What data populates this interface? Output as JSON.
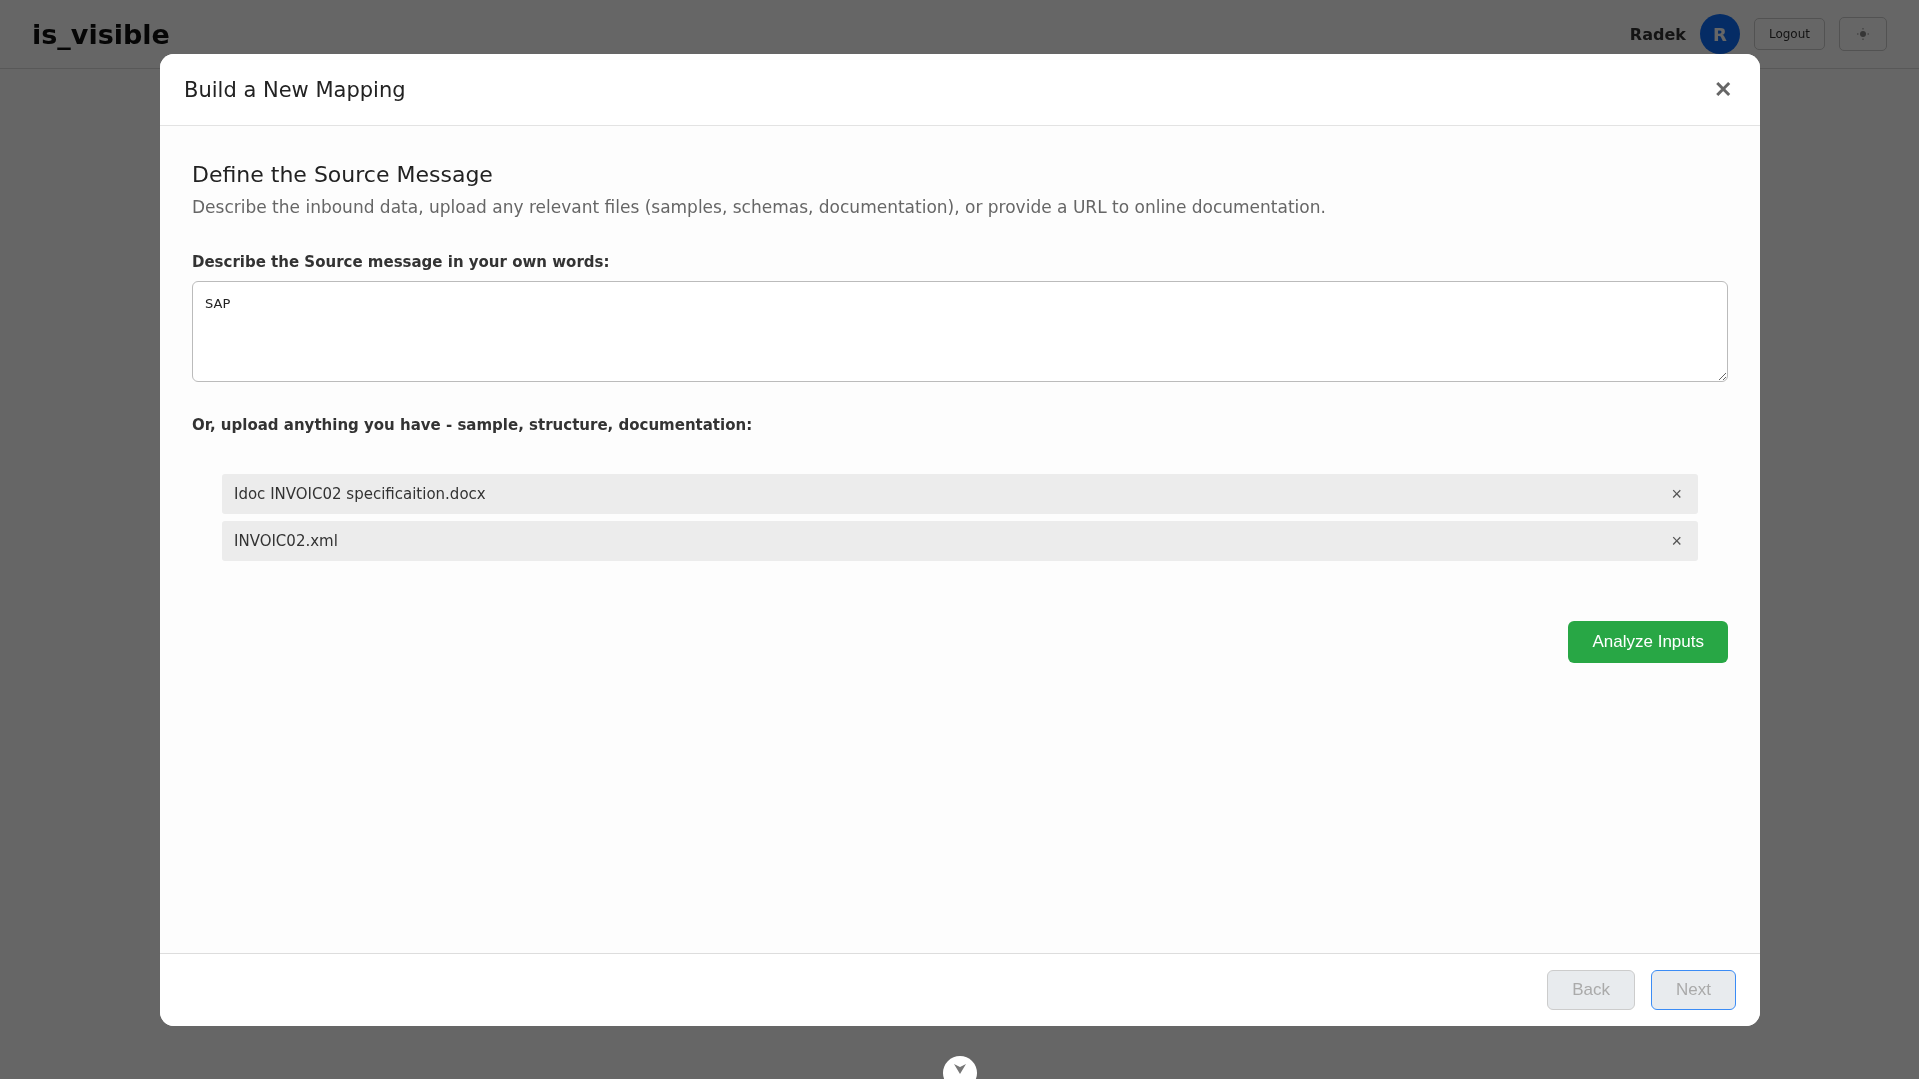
{
  "app_header": {
    "logo": "is_visible",
    "user_name": "Radek",
    "avatar_initial": "R",
    "logout_label": "Logout"
  },
  "modal": {
    "title": "Build a New Mapping",
    "close_glyph": "✕",
    "step": {
      "heading": "Define the Source Message",
      "description": "Describe the inbound data, upload any relevant files (samples, schemas, documentation), or provide a URL to online documentation.",
      "description_label": "Describe the Source message in your own words:",
      "description_value": "SAP",
      "upload_label": "Or, upload anything you have - sample, structure, documentation:",
      "files": [
        {
          "name": "Idoc INVOIC02 specificaition.docx",
          "remove_glyph": "×"
        },
        {
          "name": "INVOIC02.xml",
          "remove_glyph": "×"
        }
      ],
      "analyze_label": "Analyze Inputs"
    },
    "footer_buttons": [
      {
        "label": "Back",
        "disabled": true,
        "focused": false
      },
      {
        "label": "Next",
        "disabled": true,
        "focused": true
      }
    ]
  }
}
